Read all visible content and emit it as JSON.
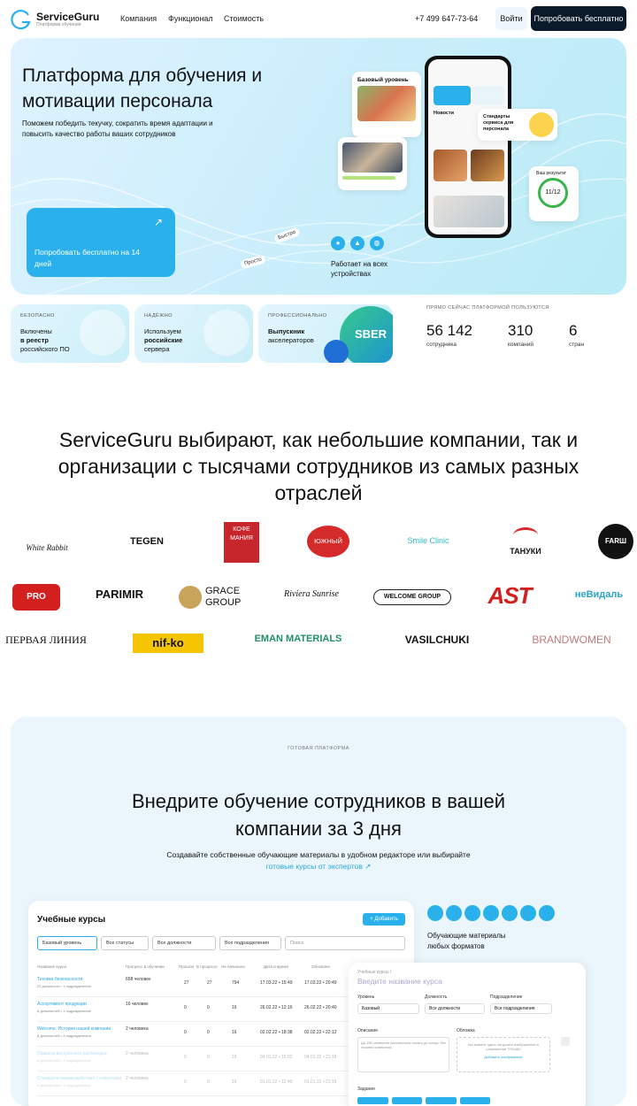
{
  "nav": {
    "brand": "ServiceGuru",
    "brand_sub": "Платформа обучения",
    "items": [
      "Компания",
      "Функционал",
      "Стоимость"
    ],
    "phone": "+7 499 647-73-64",
    "login": "Войти",
    "try": "Попробовать бесплатно"
  },
  "hero": {
    "title": "Платформа для обучения и мотивации персонала",
    "lead": "Поможем победить текучку, сократить время адаптации и повысить качество работы ваших сотрудников",
    "cta": "Попробовать бесплатно на 14 дней",
    "cta_arrow": "↗",
    "pill_fast": "Быстро",
    "pill_simple": "Просто",
    "card_level": "Базовый уровень",
    "card_news": "Новости",
    "card_standards": "Стандарты сервиса для персонала",
    "card_result": "Ваш результат",
    "result_score": "11/12",
    "devices": "Работает на всех устройствах",
    "accent": "#2ab1ec"
  },
  "badges": [
    {
      "head": "БЕЗОПАСНО",
      "line1": "Включены",
      "line2": "в реестр",
      "line3": "российского ПО"
    },
    {
      "head": "НАДЁЖНО",
      "line1": "Используем",
      "line2": "российские",
      "line3": "сервера"
    },
    {
      "head": "ПРОФЕССИОНАЛЬНО",
      "line1": "Выпускник",
      "line2": "акселераторов",
      "line3": ""
    }
  ],
  "stats": {
    "head": "ПРЯМО СЕЙЧАС ПЛАТФОРМОЙ ПОЛЬЗУЮТСЯ",
    "items": [
      {
        "value": "56 142",
        "label": "сотрудника"
      },
      {
        "value": "310",
        "label": "компаний"
      },
      {
        "value": "6",
        "label": "стран"
      }
    ]
  },
  "clients": {
    "title": "ServiceGuru выбирают, как небольшие компании, так и организации с тысячами сотрудников из самых разных отраслей",
    "row1": [
      "White Rabbit",
      "TEGEN",
      "КОФЕ МАНИЯ",
      "ЮЖНЫЙ",
      "Smile Clinic",
      "ТАНУКИ",
      "FARШ"
    ],
    "row2": [
      "PRO SUSHI",
      "PARIMIR",
      "GRACE GROUP",
      "Riviera Sunrise",
      "WELCOME GROUP",
      "AST",
      "неВидаль"
    ],
    "row3": [
      "ПЕРВАЯ ЛИНИЯ",
      "nif-ko",
      "EMAN MATERIALS",
      "VASILCHUKI",
      "BRANDWOMEN"
    ]
  },
  "platform": {
    "tag": "ГОТОВАЯ ПЛАТФОРМА",
    "title": "Внедрите обучение сотрудников в вашей компании за 3 дня",
    "sub": "Создавайте собственные обучающие материалы в удобном редакторе или выбирайте",
    "sub_link": "готовые курсы от экспертов ↗",
    "formats": "Обучающие материалы любых форматов",
    "app": {
      "title": "Учебные курсы",
      "add": "+ Добавить",
      "filters": [
        "Базовый уровень",
        "Все статусы",
        "Все должности",
        "Все подразделения",
        "Поиск"
      ],
      "columns": [
        "Название курса",
        "Прогресс в обучении",
        "Прошли",
        "В процессе",
        "Не начинали",
        "Дата и время",
        "Обновлен"
      ],
      "rows": [
        {
          "name": "Техника безопасности",
          "sub": "22 должности • 1 подразделение",
          "people": "658 человек",
          "done": "27",
          "proc": "27",
          "not": "794",
          "created": "17.03.22 • 15:49",
          "updated": "17.03.22 • 20:49"
        },
        {
          "name": "Ассортимент продукции",
          "sub": "8 должностей • 1 подразделение",
          "people": "16 человек",
          "done": "0",
          "proc": "0",
          "not": "16",
          "created": "26.02.22 • 12:16",
          "updated": "26.02.22 • 20:40"
        },
        {
          "name": "Welcome. История нашей компании",
          "sub": "8 должностей • 3 подразделения",
          "people": "2 человека",
          "done": "0",
          "proc": "0",
          "not": "16",
          "created": "02.02.22 • 18:38",
          "updated": "02.02.22 • 22:12"
        },
        {
          "name": "Правила внутреннего распорядка",
          "sub": "8 должностей • 1 подразделение",
          "people": "2 человека",
          "done": "0",
          "proc": "0",
          "not": "16",
          "created": "04.01.22 • 15:02",
          "updated": "04.01.22 • 21:16"
        },
        {
          "name": "Стандарты взаимодействия с клиентами",
          "sub": "6 должностей • 1 подразделение",
          "people": "2 человека",
          "done": "0",
          "proc": "0",
          "not": "16",
          "created": "01.01.22 • 12:40",
          "updated": "01.01.22 • 21:16"
        }
      ]
    },
    "editor": {
      "crumb": "Учебные курсы /",
      "placeholder": "Введите название курса",
      "level": "Уровень",
      "level_val": "Базовый",
      "position": "Должность",
      "position_val": "Все должности",
      "dept": "Подразделение",
      "dept_val": "Все подразделения",
      "desc": "Описание",
      "desc_ph": "До 150 символов (желательно писать до конца, без лишних символов)",
      "cover": "Обложка",
      "cover_ph": "Вы можете здесь загрузить изображение в разрешении 700х480",
      "cover_link": "Добавить изображение",
      "tasks": "Задания"
    }
  }
}
